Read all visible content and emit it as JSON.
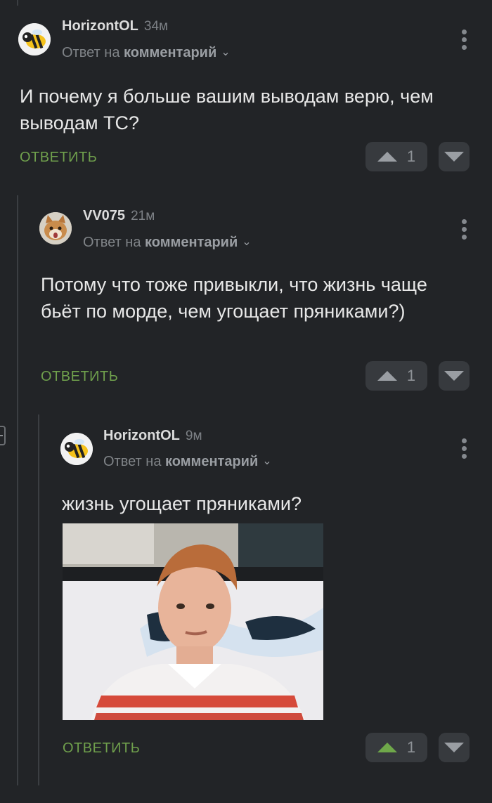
{
  "comments": [
    {
      "author": "HorizontOL",
      "time": "34м",
      "reply_prefix": "Ответ на",
      "reply_target": "комментарий",
      "text": "И почему я больше вашим выводам верю, чем выводам ТС?",
      "reply_label": "ОТВЕТИТЬ",
      "votes": "1"
    },
    {
      "author": "VV075",
      "time": "21м",
      "reply_prefix": "Ответ на",
      "reply_target": "комментарий",
      "text": "Потому что тоже привыкли, что жизнь чаще бьёт по морде, чем угощает пряниками?)",
      "reply_label": "ОТВЕТИТЬ",
      "votes": "1"
    },
    {
      "author": "HorizontOL",
      "time": "9м",
      "reply_prefix": "Ответ на",
      "reply_target": "комментарий",
      "text": "жизнь угощает пряниками?",
      "reply_label": "ОТВЕТИТЬ",
      "votes": "1",
      "image_alt": "meme-photo"
    }
  ],
  "colors": {
    "background": "#222427",
    "accent_green": "#6f9f4c",
    "upvote_active": "#6fa84a"
  }
}
